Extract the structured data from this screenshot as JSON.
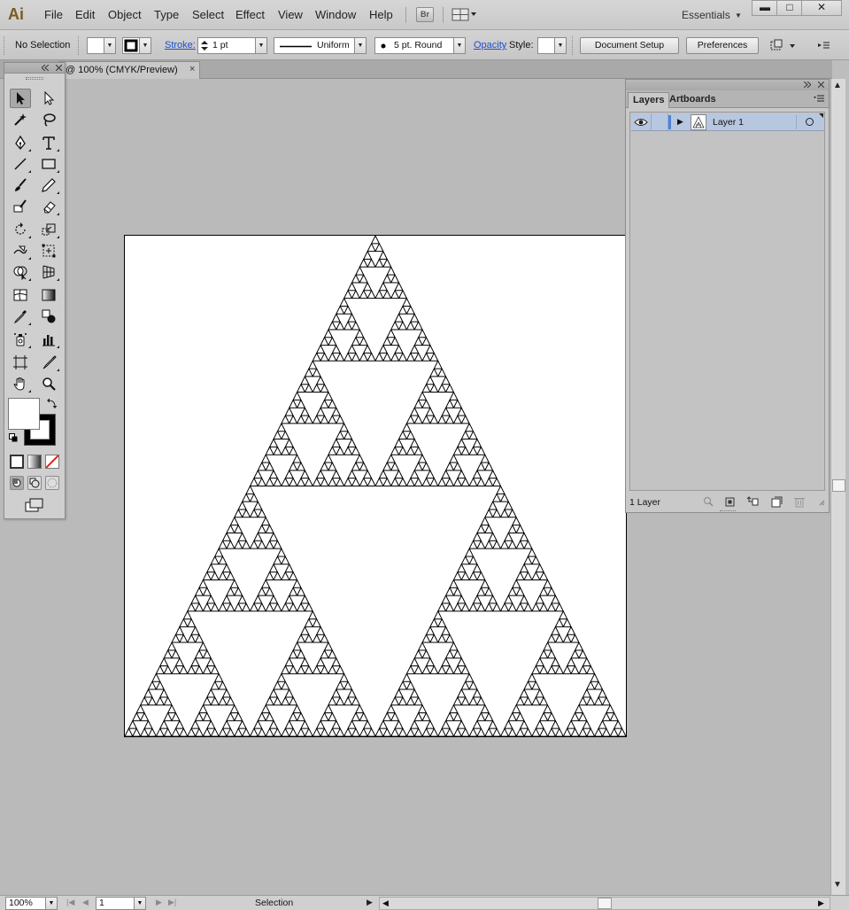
{
  "app": {
    "logo": "Ai",
    "menu": [
      "File",
      "Edit",
      "Object",
      "Type",
      "Select",
      "Effect",
      "View",
      "Window",
      "Help"
    ],
    "bridge_label": "Br",
    "workspace": "Essentials",
    "window_controls": {
      "minimize": "▬",
      "maximize": "□",
      "close": "✕"
    }
  },
  "control_bar": {
    "selection_status": "No Selection",
    "stroke_label": "Stroke:",
    "stroke_weight": "1 pt",
    "profile": "Uniform",
    "brush": "5 pt. Round",
    "opacity_label": "Opacity",
    "style_label": "Style:",
    "document_setup": "Document Setup",
    "preferences": "Preferences"
  },
  "document": {
    "tab_title": "@ 100% (CMYK/Preview)",
    "tab_close": "×",
    "fractal_depth": 6
  },
  "tools": {
    "fill_color": "#ffffff",
    "stroke_color": "#000000",
    "items": [
      "selection-tool",
      "direct-selection-tool",
      "magic-wand-tool",
      "lasso-tool",
      "pen-tool",
      "type-tool",
      "line-segment-tool",
      "rectangle-tool",
      "paintbrush-tool",
      "pencil-tool",
      "blob-brush-tool",
      "eraser-tool",
      "rotate-tool",
      "scale-tool",
      "warp-tool",
      "free-transform-tool",
      "shape-builder-tool",
      "perspective-grid-tool",
      "mesh-tool",
      "gradient-tool",
      "eyedropper-tool",
      "blend-tool",
      "symbol-sprayer-tool",
      "column-graph-tool",
      "artboard-tool",
      "slice-tool",
      "hand-tool",
      "zoom-tool"
    ]
  },
  "layers_panel": {
    "tabs": [
      "Layers",
      "Artboards"
    ],
    "active_tab": "Layers",
    "layers": [
      {
        "name": "Layer 1",
        "color": "#4f81d8",
        "visible": true
      }
    ],
    "count_label": "1 Layer"
  },
  "status_bar": {
    "zoom": "100%",
    "artboard_number": "1",
    "current_tool": "Selection"
  }
}
